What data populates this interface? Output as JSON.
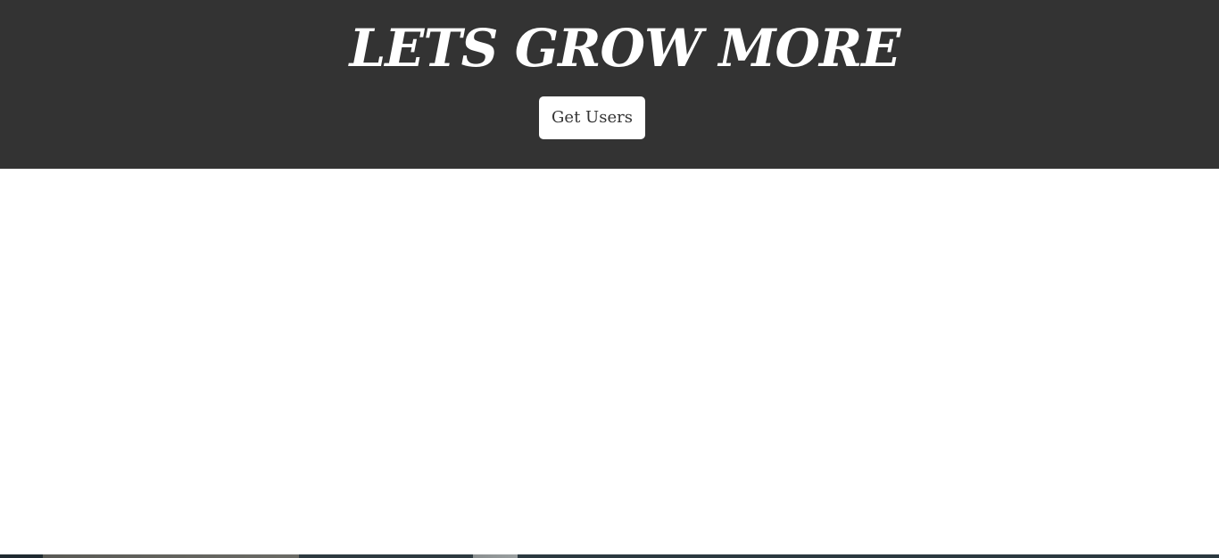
{
  "header": {
    "title": "LETS GROW MORE",
    "button_label": "Get Users"
  },
  "colors": {
    "header_background": "#333333",
    "header_text": "#ffffff",
    "button_background": "#ffffff",
    "button_text": "#333333",
    "page_background": "#ffffff"
  }
}
